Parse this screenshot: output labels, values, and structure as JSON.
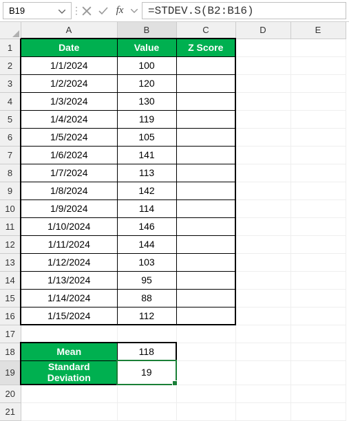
{
  "formulaBar": {
    "nameBox": "B19",
    "formula": "=STDEV.S(B2:B16)"
  },
  "columns": [
    "A",
    "B",
    "C",
    "D",
    "E"
  ],
  "rowCount": 21,
  "header": {
    "A": "Date",
    "B": "Value",
    "C": "Z Score"
  },
  "data": [
    {
      "date": "1/1/2024",
      "value": "100",
      "z": ""
    },
    {
      "date": "1/2/2024",
      "value": "120",
      "z": ""
    },
    {
      "date": "1/3/2024",
      "value": "130",
      "z": ""
    },
    {
      "date": "1/4/2024",
      "value": "119",
      "z": ""
    },
    {
      "date": "1/5/2024",
      "value": "105",
      "z": ""
    },
    {
      "date": "1/6/2024",
      "value": "141",
      "z": ""
    },
    {
      "date": "1/7/2024",
      "value": "113",
      "z": ""
    },
    {
      "date": "1/8/2024",
      "value": "142",
      "z": ""
    },
    {
      "date": "1/9/2024",
      "value": "114",
      "z": ""
    },
    {
      "date": "1/10/2024",
      "value": "146",
      "z": ""
    },
    {
      "date": "1/11/2024",
      "value": "144",
      "z": ""
    },
    {
      "date": "1/12/2024",
      "value": "103",
      "z": ""
    },
    {
      "date": "1/13/2024",
      "value": "95",
      "z": ""
    },
    {
      "date": "1/14/2024",
      "value": "88",
      "z": ""
    },
    {
      "date": "1/15/2024",
      "value": "112",
      "z": ""
    }
  ],
  "summary": {
    "meanLabel": "Mean",
    "meanValue": "118",
    "sdLabel": "Standard Deviation",
    "sdValue": "19"
  },
  "selectedCell": "B19",
  "colors": {
    "accent": "#00b050",
    "selection": "#1a7f37"
  }
}
